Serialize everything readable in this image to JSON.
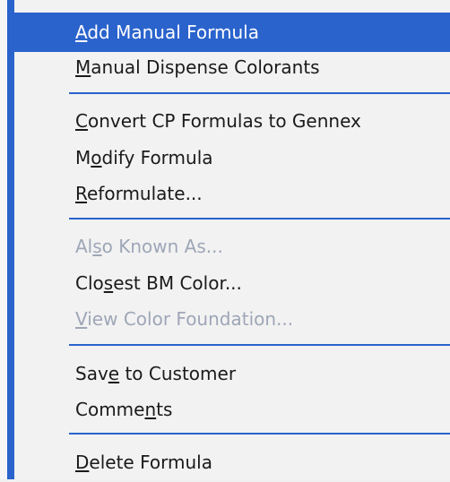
{
  "menu": {
    "items": [
      {
        "pre": "",
        "key": "A",
        "post": "dd Manual Formula",
        "state": "highlighted"
      },
      {
        "pre": "",
        "key": "M",
        "post": "anual Dispense Colorants",
        "state": "normal"
      },
      {
        "pre": "",
        "key": "C",
        "post": "onvert CP Formulas to Gennex",
        "state": "normal"
      },
      {
        "pre": "M",
        "key": "o",
        "post": "dify Formula",
        "state": "normal"
      },
      {
        "pre": "",
        "key": "R",
        "post": "eformulate...",
        "state": "normal"
      },
      {
        "pre": "Al",
        "key": "s",
        "post": "o Known As...",
        "state": "disabled"
      },
      {
        "pre": "Clo",
        "key": "s",
        "post": "est BM Color...",
        "state": "normal"
      },
      {
        "pre": "",
        "key": "V",
        "post": "iew Color Foundation...",
        "state": "disabled"
      },
      {
        "pre": "Sav",
        "key": "e",
        "post": " to Customer",
        "state": "normal"
      },
      {
        "pre": "Comme",
        "key": "n",
        "post": "ts",
        "state": "normal"
      },
      {
        "pre": "",
        "key": "D",
        "post": "elete Formula",
        "state": "normal"
      }
    ]
  },
  "colors": {
    "accent": "#2a63cc",
    "text": "#1a1a1a",
    "disabled_text": "#9ea6b7",
    "menu_background": "#f2f2f2"
  }
}
